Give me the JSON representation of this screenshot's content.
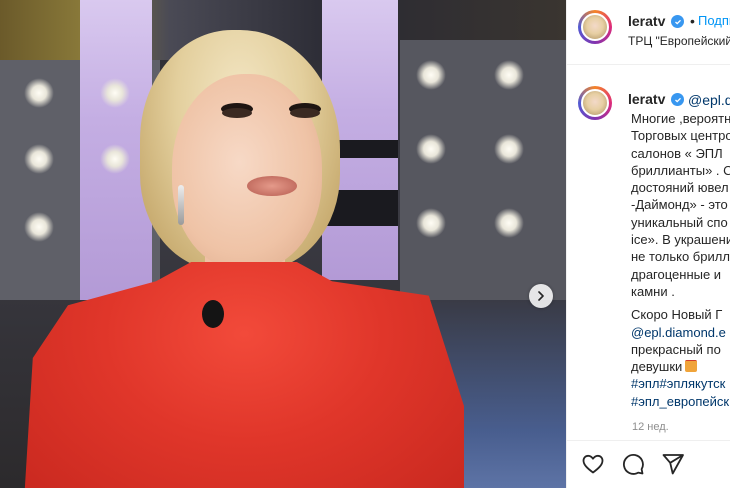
{
  "post": {
    "username": "leratv",
    "header_follow_dot": "•",
    "header_follow_label": "Подписаться",
    "location": "ТРЦ \"Европейский\"",
    "caption_mention": "@epl.diamond",
    "caption_lines": [
      "Многие ,вероятно",
      "Торговых центров",
      "салонов « ЭПЛ",
      "бриллианты» . С",
      "достояний ювел",
      "-Даймонд» - это",
      "уникальный спо",
      "ice». В украшени",
      "не только брилл",
      "драгоценные и",
      "камни ."
    ],
    "caption_lines_2": [
      "Скоро Новый Г"
    ],
    "caption_link_line": "@epl.diamond.e",
    "caption_lines_3": [
      "прекрасный по"
    ],
    "caption_gift_line": "девушки",
    "hashtag_lines": [
      "#эпл#эплякутск",
      "#эпл_европейск"
    ],
    "timestamp": "12 нед."
  },
  "icons": {
    "verified": "verified-badge-icon",
    "next": "chevron-right-icon",
    "like": "heart-icon",
    "comment": "comment-icon",
    "share": "paper-plane-icon",
    "gift": "gift-emoji-icon"
  },
  "colors": {
    "link": "#00376b",
    "follow": "#0095f6",
    "verified": "#3897f0",
    "muted": "#8e8e8e",
    "dress": "#e0362a"
  }
}
